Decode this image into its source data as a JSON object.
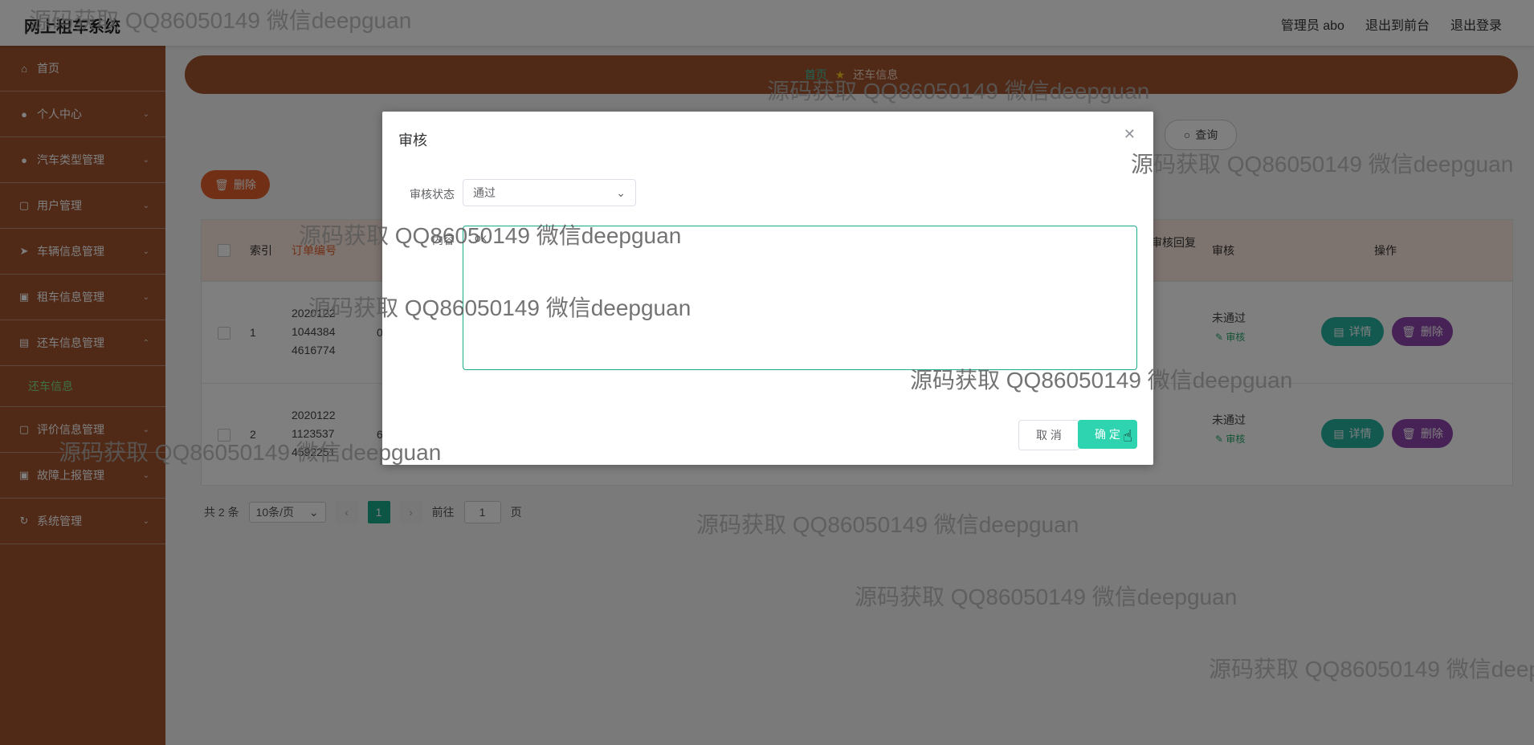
{
  "header": {
    "app_title": "网上租车系统",
    "user": "管理员 abo",
    "to_front": "退出到前台",
    "logout": "退出登录"
  },
  "sidebar": {
    "items": [
      {
        "label": "首页",
        "icon": "home-icon"
      },
      {
        "label": "个人中心",
        "icon": "user-icon"
      },
      {
        "label": "汽车类型管理",
        "icon": "user-icon"
      },
      {
        "label": "用户管理",
        "icon": "chat-icon"
      },
      {
        "label": "车辆信息管理",
        "icon": "send-icon"
      },
      {
        "label": "租车信息管理",
        "icon": "briefcase-icon"
      },
      {
        "label": "还车信息管理",
        "icon": "document-icon"
      }
    ],
    "sub_item": "还车信息",
    "items_after": [
      {
        "label": "评价信息管理",
        "icon": "square-icon"
      },
      {
        "label": "故障上报管理",
        "icon": "briefcase-icon"
      },
      {
        "label": "系统管理",
        "icon": "refresh-icon"
      }
    ]
  },
  "breadcrumb": {
    "home": "首页",
    "current": "还车信息"
  },
  "toolbar": {
    "query_label": "查询",
    "delete_label": "删除"
  },
  "table": {
    "headers": {
      "index": "索引",
      "order": "订单编号",
      "reply": "审核回复",
      "audit": "审核",
      "actions": "操作"
    },
    "rows": [
      {
        "index": "1",
        "order_lines": [
          "2020122",
          "1044384",
          "4616774"
        ],
        "col2": "0",
        "status": "未通过",
        "audit_link": "审核"
      },
      {
        "index": "2",
        "order_lines": [
          "2020122",
          "1123537",
          "4592251"
        ],
        "col2": "6",
        "status": "未通过",
        "audit_link": "审核"
      }
    ],
    "detail_label": "详情",
    "delete_label": "删除"
  },
  "pager": {
    "total": "共 2 条",
    "page_size": "10条/页",
    "current": "1",
    "goto_prefix": "前往",
    "goto_value": "1",
    "goto_suffix": "页"
  },
  "dialog": {
    "title": "审核",
    "status_label": "审核状态",
    "status_value": "通过",
    "content_label": "内容",
    "content_value": "ok",
    "cancel_label": "取 消",
    "ok_label": "确 定"
  },
  "watermark": "源码获取 QQ86050149 微信deepguan"
}
